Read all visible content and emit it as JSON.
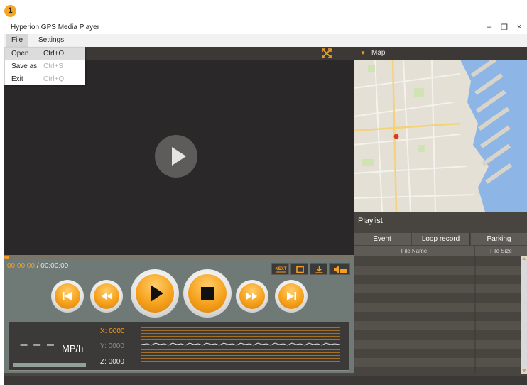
{
  "marker": "1",
  "window": {
    "title": "Hyperion GPS Media Player",
    "controls": {
      "minimize": "–",
      "maximize": "❐",
      "close": "×"
    }
  },
  "menubar": {
    "file": "File",
    "settings": "Settings"
  },
  "file_menu": {
    "items": [
      {
        "label": "Open",
        "shortcut": "Ctrl+O"
      },
      {
        "label": "Save as",
        "shortcut": "Ctrl+S"
      },
      {
        "label": "Exit",
        "shortcut": "Ctrl+Q"
      }
    ]
  },
  "player": {
    "time_current": "00:00:00",
    "time_separator": " / ",
    "time_total": "00:00:00",
    "progress": 0,
    "toolbar_icons": [
      "next-file-icon",
      "fullscreen-square-icon",
      "download-icon",
      "volume-icon"
    ],
    "next_label": "NEXT",
    "transport_icons": [
      "skip-previous-icon",
      "rewind-icon",
      "play-icon",
      "stop-icon",
      "fast-forward-icon",
      "skip-next-icon"
    ]
  },
  "readout": {
    "speed": "– – –",
    "speed_unit": "MP/h",
    "x": "X: 0000",
    "y": "Y: 0000",
    "z": "Z: 0000"
  },
  "map": {
    "title": "Map"
  },
  "playlist": {
    "title": "Playlist",
    "tabs": [
      "Event",
      "Loop record",
      "Parking"
    ],
    "columns": [
      "File Name",
      "File Size"
    ],
    "rows": []
  },
  "colors": {
    "accent": "#f1a025",
    "panel": "#48443f",
    "video_bg": "#2a2828",
    "controls_bg": "#6f7975"
  }
}
